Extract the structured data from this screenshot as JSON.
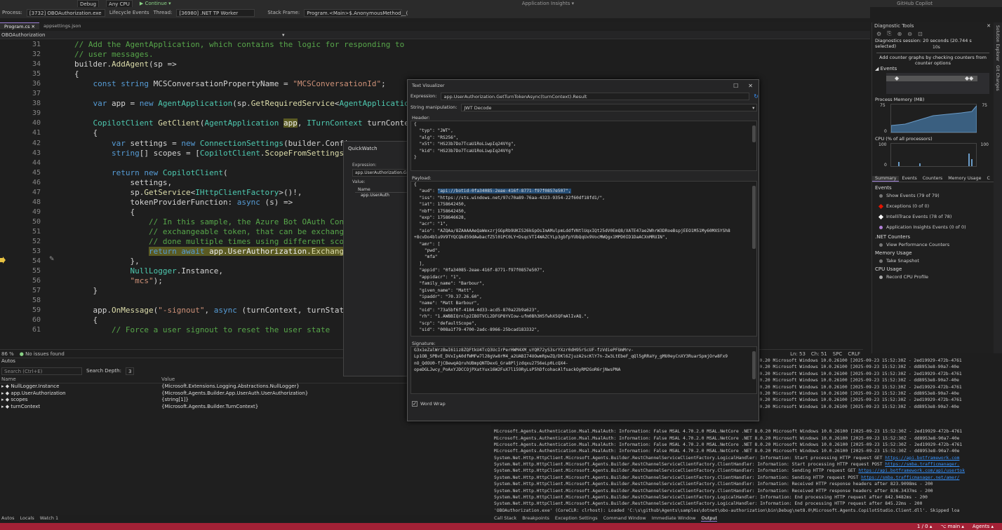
{
  "toolbar": {
    "items": [
      "Debug",
      "Any CPU",
      "▶ Continue ▾",
      "Application Insights ▾",
      "GitHub Copilot"
    ],
    "process_label": "Process:",
    "process_value": "[3732] OBOAuthorization.exe",
    "lifecycle": "Lifecycle Events",
    "thread_label": "Thread:",
    "thread_value": "[36980] .NET TP Worker",
    "stackframe_label": "Stack Frame:",
    "stackframe_value": "Program.<Main>$.AnonymousMethod__("
  },
  "tabs": [
    "Program.cs",
    "appsettings.json"
  ],
  "title_tab": "OBOAuthorization",
  "navbar": {
    "project": "OBOAuthorization"
  },
  "editor": {
    "lines": [
      {
        "n": "31",
        "html": "<span class=\"c\">// Add the AgentApplication, which contains the logic for responding to</span>",
        "indent": 0
      },
      {
        "n": "32",
        "html": "<span class=\"c\">// user messages.</span>",
        "indent": 0
      },
      {
        "n": "34",
        "html": "builder.<span class=\"m\">AddAgent</span>(sp =>",
        "indent": 0
      },
      {
        "n": "35",
        "html": "{",
        "indent": 0
      },
      {
        "n": "36",
        "html": "    <span class=\"k\">const</span> <span class=\"k\">string</span> MCSConversationPropertyName = <span class=\"s\">\"MCSConversationId\"</span>;",
        "indent": 0
      },
      {
        "n": "37",
        "html": "",
        "indent": 0
      },
      {
        "n": "38",
        "html": "    <span class=\"k\">var</span> app = <span class=\"k\">new</span> <span class=\"t\">AgentApplication</span>(sp.<span class=\"m\">GetRequiredService</span>&lt;<span class=\"t\">AgentApplicationOpt</span>",
        "indent": 0
      },
      {
        "n": "39",
        "html": "",
        "indent": 0
      },
      {
        "n": "40",
        "html": "    <span class=\"t\">CopilotClient</span> <span class=\"m\">GetClient</span>(<span class=\"t\">AgentApplication</span> <span class=\"hl\">app</span>, <span class=\"t\">ITurnContext</span> turnContext)",
        "indent": 0
      },
      {
        "n": "41",
        "html": "    {",
        "indent": 0
      },
      {
        "n": "42",
        "html": "        <span class=\"k\">var</span> settings = <span class=\"k\">new</span> <span class=\"t\">ConnectionSettings</span>(builder.Configu",
        "indent": 0
      },
      {
        "n": "43",
        "html": "        <span class=\"k\">string</span>[] scopes = [<span class=\"t\">CopilotClient</span>.<span class=\"m\">ScopeFromSettings</span>(se",
        "indent": 0
      },
      {
        "n": "44",
        "html": "",
        "indent": 0
      },
      {
        "n": "45",
        "html": "        <span class=\"k\">return</span> <span class=\"k\">new</span> <span class=\"t\">CopilotClient</span>(",
        "indent": 0
      },
      {
        "n": "46",
        "html": "            settings,",
        "indent": 0
      },
      {
        "n": "47",
        "html": "            sp.<span class=\"m\">GetService</span>&lt;<span class=\"t\">IHttpClientFactory</span>&gt;()!,",
        "indent": 0
      },
      {
        "n": "48",
        "html": "            tokenProviderFunction: <span class=\"k\">async</span> (s) =>",
        "indent": 0
      },
      {
        "n": "49",
        "html": "            {",
        "indent": 0
      },
      {
        "n": "50",
        "html": "                <span class=\"c\">// In this sample, the Azure Bot OAuth Connec</span>",
        "indent": 0
      },
      {
        "n": "51",
        "html": "                <span class=\"c\">// exchangeable token, that can be exchange f</span>",
        "indent": 0
      },
      {
        "n": "52",
        "html": "                <span class=\"c\">// done multiple times using different scopes</span>",
        "indent": 0
      },
      {
        "n": "53",
        "html": "                <span class=\"hl\"><span class=\"k\">return</span> <span class=\"k\">await</span> app.UserAuthorization.<span class=\"m\">ExchangeTu</span></span>",
        "indent": 0
      },
      {
        "n": "54",
        "html": "            },",
        "indent": 0
      },
      {
        "n": "55",
        "html": "            <span class=\"t\">NullLogger</span>.Instance,",
        "indent": 0
      },
      {
        "n": "56",
        "html": "            <span class=\"s\">\"mcs\"</span>);",
        "indent": 0
      },
      {
        "n": "57",
        "html": "    }",
        "indent": 0
      },
      {
        "n": "58",
        "html": "",
        "indent": 0
      },
      {
        "n": "59",
        "html": "    app.<span class=\"m\">OnMessage</span>(<span class=\"s\">\"-signout\"</span>, <span class=\"k\">async</span> (turnContext, turnState,",
        "indent": 0
      },
      {
        "n": "60",
        "html": "    {",
        "indent": 0
      },
      {
        "n": "61",
        "html": "        <span class=\"c\">// Force a user signout to reset the user state</span>",
        "indent": 0
      }
    ]
  },
  "editor_status": {
    "zoom": "86 %",
    "issues": "No issues found",
    "ln": "Ln: 53",
    "ch": "Ch: 51",
    "spc": "SPC",
    "crlf": "CRLF"
  },
  "autos": {
    "title": "Autos",
    "search_placeholder": "Search (Ctrl+E)",
    "search_depth_label": "Search Depth:",
    "search_depth": "3",
    "col_name": "Name",
    "col_value": "Value",
    "rows": [
      {
        "name": "NullLogger.Instance",
        "value": "{Microsoft.Extensions.Logging.Abstractions.NullLogger}"
      },
      {
        "name": "app.UserAuthorization",
        "value": "{Microsoft.Agents.Builder.App.UserAuth.UserAuthorization}"
      },
      {
        "name": "scopes",
        "value": "{string[1]}",
        "view": "View ▾"
      },
      {
        "name": "turnContext",
        "value": "{Microsoft.Agents.Builder.TurnContext}"
      }
    ]
  },
  "bottom_tabs_left": [
    "Autos",
    "Locals",
    "Watch 1"
  ],
  "bottom_tabs_right": [
    "Call Stack",
    "Breakpoints",
    "Exception Settings",
    "Command Window",
    "Immediate Window",
    "Output"
  ],
  "output": {
    "lines": [
      ".NET 8.0.20 Microsoft Windows 10.0.26100 [2025-09-23 15:52:30Z - 2ed19929-472b-4761",
      ".NET 8.0.20 Microsoft Windows 10.0.26100 [2025-09-23 15:52:30Z - dd8953e8-90a7-40e",
      ".NET 8.0.20 Microsoft Windows 10.0.26100 [2025-09-23 15:52:30Z - 2ed19929-472b-4761",
      ".NET 8.0.20 Microsoft Windows 10.0.26100 [2025-09-23 15:52:30Z - dd8953e8-90a7-40e",
      ".NET 8.0.20 Microsoft Windows 10.0.26100 [2025-09-23 15:52:30Z - 2ed19929-472b-4761",
      ".NET 8.0.20 Microsoft Windows 10.0.26100 [2025-09-23 15:52:30Z - dd8953e8-90a7-40e",
      ".NET 8.0.20 Microsoft Windows 10.0.26100 [2025-09-23 15:52:30Z - 2ed19929-472b-4761",
      ".NET 8.0.20 Microsoft Windows 10.0.26100 [2025-09-23 15:52:30Z - dd8953e8-90a7-40e",
      "Microsoft.Agents.Authentication.Msal.MsalAuth: Information: False MSAL 4.70.2.0 MSAL.NetCore .NET 8.0.20 Microsoft Windows 10.0.26100 [2025-09-23 15:52:30Z - 2ed19929-472b-4761",
      "Microsoft.Agents.Authentication.Msal.MsalAuth: Information: False MSAL 4.70.2.0 MSAL.NetCore .NET 8.0.20 Microsoft Windows 10.0.26100 [2025-09-23 15:52:30Z - dd8953e8-90a7-40e",
      "Microsoft.Agents.Authentication.Msal.MsalAuth: Information: False MSAL 4.70.2.0 MSAL.NetCore .NET 8.0.20 Microsoft Windows 10.0.26100 [2025-09-23 15:52:30Z - 2ed19929-472b-4761",
      "Microsoft.Agents.Authentication.Msal.MsalAuth: Information: False MSAL 4.70.2.0 MSAL.NetCore .NET 8.0.20 Microsoft Windows 10.0.26100 [2025-09-23 15:52:30Z - dd8953e8-90a7-40e",
      "System.Net.Http.HttpClient.Microsoft.Agents.Builder.RestChannelServiceClientFactory.LogicalHandler: Information: Start processing HTTP request GET https://api.botframework.com",
      "System.Net.Http.HttpClient.Microsoft.Agents.Builder.RestChannelServiceClientFactory.ClientHandler: Information: Start processing HTTP request POST https://smba.trafficmanager.",
      "System.Net.Http.HttpClient.Microsoft.Agents.Builder.RestChannelServiceClientFactory.ClientHandler: Information: Sending HTTP request GET https://api.botframework.com/api/usertok",
      "System.Net.Http.HttpClient.Microsoft.Agents.Builder.RestChannelServiceClientFactory.ClientHandler: Information: Sending HTTP request POST https://smba.trafficmanager.net/amer/",
      "System.Net.Http.HttpClient.Microsoft.Agents.Builder.RestChannelServiceClientFactory.ClientHandler: Information: Received HTTP response headers after 823.9098ms - 200",
      "System.Net.Http.HttpClient.Microsoft.Agents.Builder.RestChannelServiceClientFactory.ClientHandler: Information: Received HTTP response headers after 836.3437ms - 200",
      "System.Net.Http.HttpClient.Microsoft.Agents.Builder.RestChannelServiceClientFactory.LogicalHandler: Information: End processing HTTP request after 842.9482ms - 200",
      "System.Net.Http.HttpClient.Microsoft.Agents.Builder.RestChannelServiceClientFactory.LogicalHandler: Information: End processing HTTP request after 845.22ms - 200",
      "'OBOAuthorization.exe' (CoreCLR: clrhost): Loaded 'C:\\s\\github\\Agents\\samples\\dotnet\\obo-authorization\\bin\\Debug\\net8.0\\Microsoft.Agents.CopilotStudio.Client.dll'. Skipped loa"
    ]
  },
  "diag": {
    "title": "Diagnostic Tools",
    "session": "Diagnostics session: 20 seconds (20.744 s selected)",
    "tick_10s": "10s",
    "hint": "Add counter graphs by checking counters from counter options",
    "events_label": "Events",
    "process_memory": "Process Memory (MB)",
    "mem_max": "75",
    "mem_min": "0",
    "cpu_label": "CPU (% of all processors)",
    "cpu_max": "100",
    "cpu_min": "0",
    "tabs": [
      "Summary",
      "Events",
      "Counters",
      "Memory Usage",
      "C"
    ],
    "events_section": "Events",
    "show_events": "Show Events (79 of 79)",
    "exceptions": "Exceptions (0 of 0)",
    "intellitrace": "IntelliTrace Events (78 of 78)",
    "appinsights": "Application Insights Events (0 of 0)",
    "net_counters": ".NET Counters",
    "view_perf": "View Performance Counters",
    "memory_usage": "Memory Usage",
    "take_snapshot": "Take Snapshot",
    "cpu_usage": "CPU Usage",
    "record_cpu": "Record CPU Profile",
    "colors": {
      "exception": "#e51400",
      "intellitrace": "#ffffff",
      "appinsights": "#b180d7"
    }
  },
  "right_strip": [
    "Solution Explorer",
    "Git Changes"
  ],
  "quickwatch": {
    "title": "QuickWatch",
    "expression_label": "Expression:",
    "expression_value": "app.UserAuthorization.Ge",
    "value_label": "Value:",
    "col_name": "Name",
    "row": "app.UserAuth"
  },
  "tv": {
    "title": "Text Visualizer",
    "expression_label": "Expression:",
    "expression_value": "app.UserAuthorization.GetTurnTokenAsync(turnContext).Result",
    "manip_label": "String manipulation:",
    "manip_value": "JWT Decode",
    "header_label": "Header:",
    "header_lines": [
      "{",
      "  \"typ\": \"JWT\",",
      "  \"alg\": \"RS256\",",
      "  \"x5t\": \"HS23b7Do7TcaU1RoLiwpIq24VYg\",",
      "  \"kid\": \"HS23b7Do7TcaU1RoLiwpIq24VYg\"",
      "}"
    ],
    "payload_label": "Payload:",
    "payload_lines": [
      "{",
      "  \"aud\": \"api://botid-0fa34085-2eae-416f-8771-f97f0857e507\",",
      "  \"iss\": \"https://sts.windows.net/97c70a89-76aa-4323-9354-22f60df18fd1/\",",
      "  \"iat\": 1758642450,",
      "  \"nbf\": 1758642450,",
      "  \"exp\": 1758646628,",
      "  \"acr\": \"1\",",
      "  \"aio\": \"AZQAa/8ZAAAAAeQaWexzrjGGpRb9UKIS26kGpOsImAMulpmLddfVNtlUqxIQt25dV0EmQ8/XATE47ae2WhrW3DRoeBspjEEO1M51My60MXSYSh8",
      "+8cvDo4blu9V9TYQCQkd59dAwbacfZ5l01PC0LY+DsqcVTI4WAZCYLp3gbfpYUbQqUx9VocMWQgx1MPD0ID1DaACXnMRUIN\",",
      "  \"amr\": [",
      "    \"pwd\",",
      "    \"mfa\"",
      "  ],",
      "  \"appid\": \"0fa34085-2eae-416f-8771-f97f0857e507\",",
      "  \"appidacr\": \"1\",",
      "  \"family_name\": \"Barbour\",",
      "  \"given_name\": \"Matt\",",
      "  \"ipaddr\": \"70.37.26.60\",",
      "  \"name\": \"Matt Barbour\",",
      "  \"oid\": \"73a5bf6f-4184-4d33-acd5-870a22b9a623\",",
      "  \"rh\": \"1.AWBBIQrnlp2IBOTVCL2DFGP8YVIow-ufm0Bh3H5fwhX5QFmAlIvAQ.\",",
      "  \"scp\": \"defaultScope\",",
      "  \"sid\": \"008a1f79-4700-2adc-8966-25bcad183332\","
    ],
    "signature_label": "Signature:",
    "signature_lines": [
      "G3x1eZalWrzBwI61iz8ZQFtkU4TcQ3UcIrPerHWM4XM_uYQR72yS3srYXzr0dH95rScUF-fzVdiePFUmMrv-",
      "Lp1OB_SPBvE_DVxIyA0dfWMFw7l28gVw8rM4_a2UABI74UOwmRpwZQ/DKl6ZjuzA2scKlY7n-Zw3LtEbeF_qQl5gRRaYy_gMU0eyCnXY3RuarSpmjOrw8Fx9",
      "nO_QdOU0-fjCBewqAQruhUBmpQNTDexG_Gra8Pljzdqxu2756eLp0LcQX4-",
      "opeDGLJwcy_PoAxYJDCCOjPXatYux16W2FuX7l159RyLsP5hDfcohacAlfsackOyRM2GoR6rjNwsPNA"
    ],
    "wordwrap_label": "Word Wrap"
  },
  "statusbar": {
    "pos": "1 / 0 ▴",
    "main": "⌥ main ▴",
    "agents": "Agents ▴"
  }
}
